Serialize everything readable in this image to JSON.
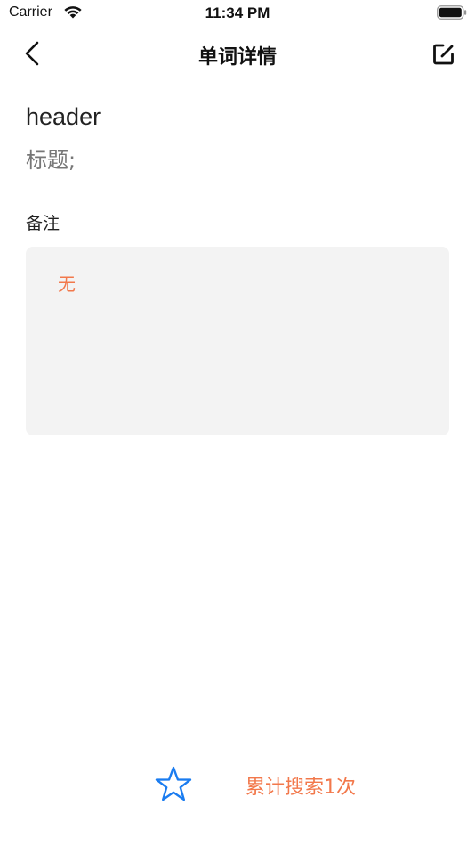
{
  "status_bar": {
    "carrier": "Carrier",
    "time": "11:34 PM"
  },
  "nav": {
    "title": "单词详情",
    "back_icon": "chevron-left-icon",
    "edit_icon": "edit-square-icon"
  },
  "word": {
    "text": "header",
    "meaning": "标题;"
  },
  "note": {
    "label": "备注",
    "content": "无"
  },
  "footer": {
    "favorite_icon": "star-outline-icon",
    "search_count": "累计搜索1次"
  },
  "colors": {
    "accent_orange": "#f2784b",
    "star_blue": "#1a7cf0",
    "note_background": "#f3f3f3"
  }
}
